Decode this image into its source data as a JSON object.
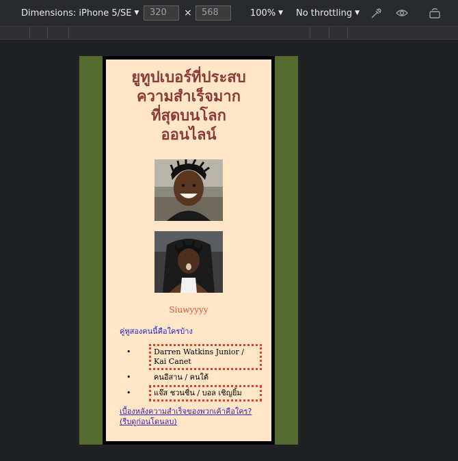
{
  "toolbar": {
    "device_label": "Dimensions: iPhone 5/SE",
    "width": "320",
    "height": "568",
    "times": "×",
    "zoom": "100%",
    "throttling": "No throttling",
    "icons": [
      "eyedropper-icon",
      "eye-icon",
      "rotate-icon"
    ]
  },
  "page": {
    "title_lines": [
      "ยูทูปเบอร์ที่ประสบ",
      "ความสำเร็จมาก",
      "ที่สุดบนโลก",
      "ออนไลน์"
    ],
    "caption": "Siuwyyyy",
    "question_link": "คู่หูสองคนนี้คือใครบ้าง",
    "list_items": [
      "Darren Watkins Junior / Kai Canet",
      "คนอีสาน / คนใต้",
      "แจ๊ส ชวนชื่น / บอล เชิญยิ้ม"
    ],
    "bottom_link": "เบื้องหลังความสำเร็จของพวกเค้าคือใคร? (รีบดูก่อนโดนลบ)"
  },
  "colors": {
    "page_bg": "#ffe6c7",
    "side_bg": "#556b2f",
    "title": "#8b3a3a",
    "caption": "#e0503c",
    "link": "#1c1cd6",
    "dotted_border": "#e33b2e"
  }
}
